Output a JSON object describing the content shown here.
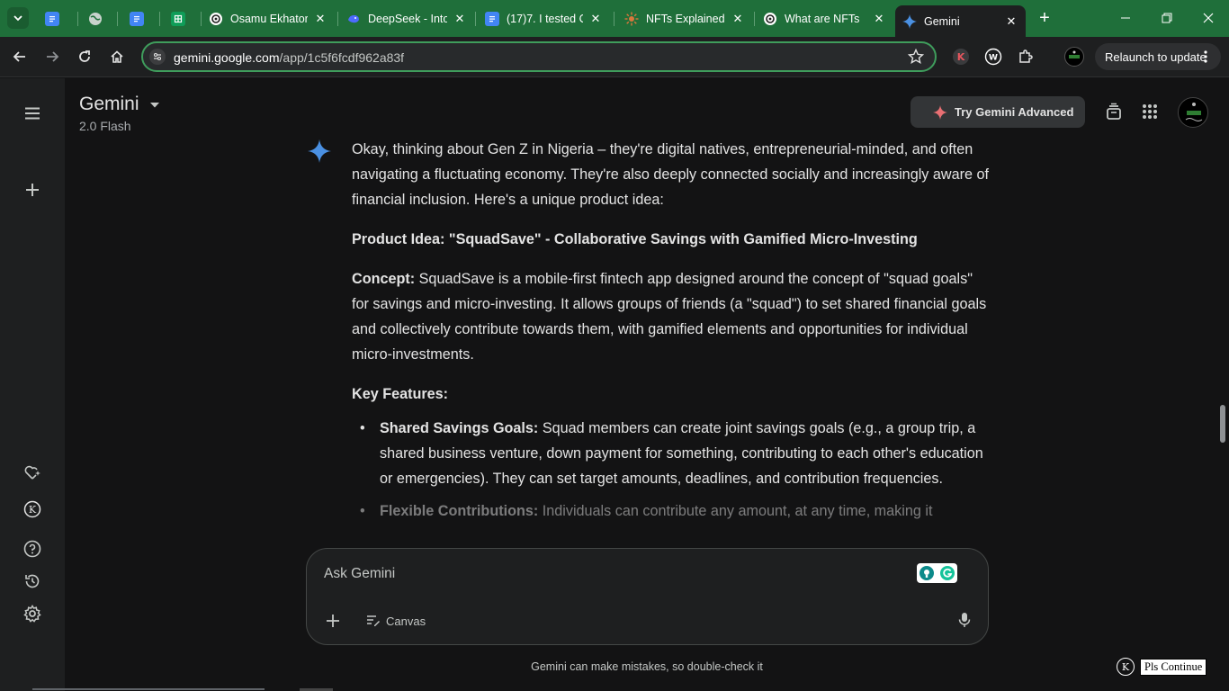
{
  "browser": {
    "tabs": [
      {
        "label": "",
        "icon": "docs-icon"
      },
      {
        "label": "",
        "icon": "globe-icon"
      },
      {
        "label": "",
        "icon": "docs-icon"
      },
      {
        "label": "",
        "icon": "sheets-icon"
      },
      {
        "label": "Osamu Ekhator",
        "icon": "openai-icon"
      },
      {
        "label": "DeepSeek - Into",
        "icon": "deepseek-icon"
      },
      {
        "label": "(17)7. I tested C",
        "icon": "docs-icon"
      },
      {
        "label": "NFTs Explained",
        "icon": "sun-icon"
      },
      {
        "label": "What are NFTs",
        "icon": "openai-icon"
      },
      {
        "label": "Gemini",
        "icon": "gemini-icon",
        "active": true
      }
    ],
    "url_host": "gemini.google.com",
    "url_path": "/app/1c5f6fcdf962a83f",
    "relaunch_label": "Relaunch to update",
    "colors": {
      "tabstrip": "#1f6f3a",
      "omnibox_border": "#3f9d5c"
    }
  },
  "header": {
    "brand": "Gemini",
    "model": "2.0 Flash",
    "try_advanced": "Try Gemini Advanced"
  },
  "response": {
    "intro": "Okay, thinking about Gen Z in Nigeria – they're digital natives, entrepreneurial-minded, and often navigating a fluctuating economy. They're also deeply connected socially and increasingly aware of financial inclusion. Here's a unique product idea:",
    "product_idea": "Product Idea: \"SquadSave\" - Collaborative Savings with Gamified Micro-Investing",
    "concept_label": "Concept:",
    "concept_text": " SquadSave is a mobile-first fintech app designed around the concept of \"squad goals\" for savings and micro-investing. It allows groups of friends (a \"squad\") to set shared financial goals and collectively contribute towards them, with gamified elements and opportunities for individual micro-investments.",
    "features_heading": "Key Features:",
    "features": [
      {
        "title": "Shared Savings Goals:",
        "text": " Squad members can create joint savings goals (e.g., a group trip, a shared business venture, down payment for something, contributing to each other's education or emergencies). They can set target amounts, deadlines, and contribution frequencies."
      },
      {
        "title": "Flexible Contributions:",
        "text": " Individuals can contribute any amount, at any time, making it"
      }
    ]
  },
  "input": {
    "placeholder": "Ask Gemini",
    "canvas_label": "Canvas"
  },
  "disclaimer": "Gemini can make mistakes, so double-check it",
  "overlay": {
    "k_badge": "K",
    "pls_label": "Pls Continue"
  },
  "colors": {
    "background": "#131314",
    "rail": "#1e1f20",
    "gemini_blue": "#4a90e2",
    "advanced_spark": "#e86f73"
  }
}
